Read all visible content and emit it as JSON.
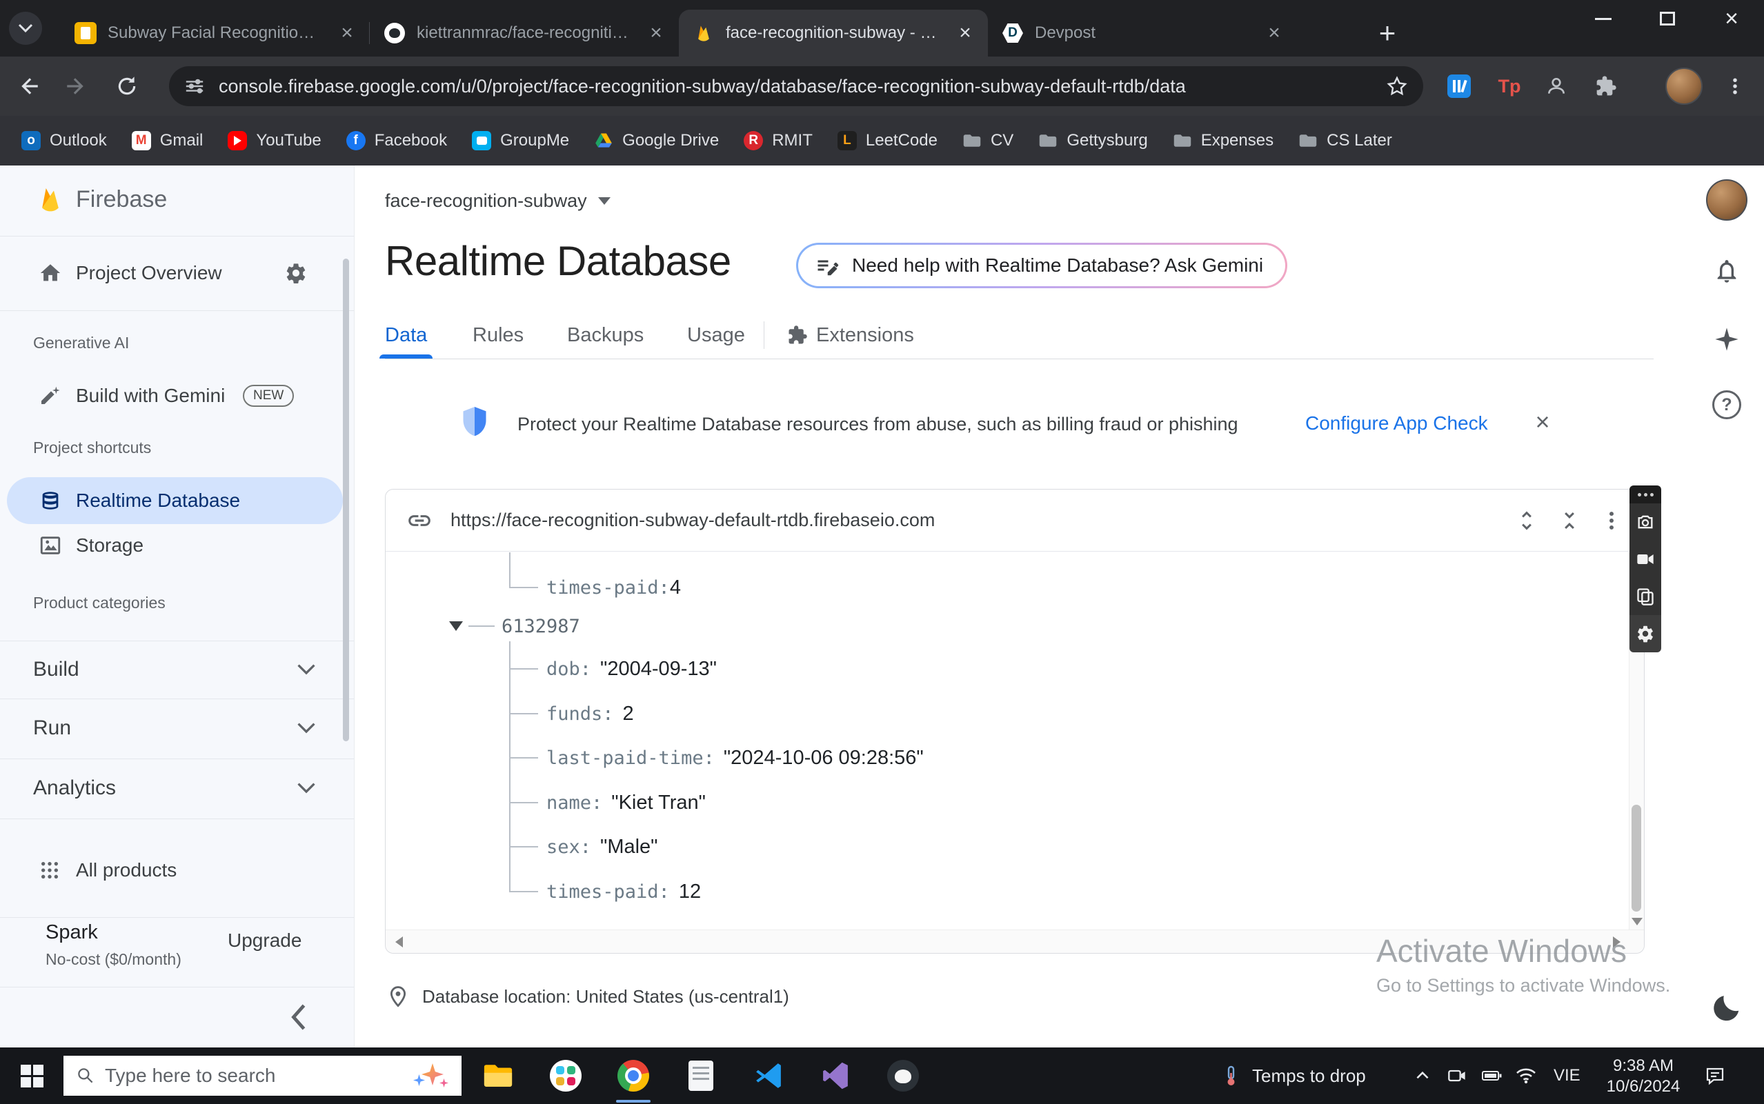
{
  "colors": {
    "accent_blue": "#1a73e8",
    "selected_nav_bg": "#d3e3fd",
    "firebase_orange": "#ffa000",
    "chrome_dark": "#202124"
  },
  "browser": {
    "tabs": [
      {
        "title": "Subway Facial Recognition - Go",
        "icon": "google-docs-icon"
      },
      {
        "title": "kiettranmrac/face-recognition-s",
        "icon": "github-icon"
      },
      {
        "title": "face-recognition-subway - Real",
        "icon": "firebase-icon"
      },
      {
        "title": "Devpost",
        "icon": "devpost-icon"
      }
    ],
    "url": "console.firebase.google.com/u/0/project/face-recognition-subway/database/face-recognition-subway-default-rtdb/data",
    "extensions": {
      "tp_label": "Tp"
    },
    "bookmarks": [
      {
        "label": "Outlook",
        "icon": "outlook-icon"
      },
      {
        "label": "Gmail",
        "icon": "gmail-icon"
      },
      {
        "label": "YouTube",
        "icon": "youtube-icon"
      },
      {
        "label": "Facebook",
        "icon": "facebook-icon"
      },
      {
        "label": "GroupMe",
        "icon": "groupme-icon"
      },
      {
        "label": "Google Drive",
        "icon": "google-drive-icon"
      },
      {
        "label": "RMIT",
        "icon": "rmit-icon"
      },
      {
        "label": "LeetCode",
        "icon": "leetcode-icon"
      },
      {
        "label": "CV",
        "icon": "folder-icon"
      },
      {
        "label": "Gettysburg",
        "icon": "folder-icon"
      },
      {
        "label": "Expenses",
        "icon": "folder-icon"
      },
      {
        "label": "CS Later",
        "icon": "folder-icon"
      }
    ]
  },
  "sidebar": {
    "brand": "Firebase",
    "project_overview": "Project Overview",
    "generative_ai_label": "Generative AI",
    "gemini_item": "Build with Gemini",
    "gemini_badge": "NEW",
    "shortcuts_label": "Project shortcuts",
    "shortcut_rtdb": "Realtime Database",
    "shortcut_storage": "Storage",
    "categories_label": "Product categories",
    "category_build": "Build",
    "category_run": "Run",
    "category_analytics": "Analytics",
    "all_products": "All products",
    "plan_name": "Spark",
    "plan_detail": "No-cost ($0/month)",
    "upgrade_label": "Upgrade"
  },
  "main": {
    "project_name": "face-recognition-subway",
    "page_title": "Realtime Database",
    "gemini_help": "Need help with Realtime Database? Ask Gemini",
    "tabs": {
      "data": "Data",
      "rules": "Rules",
      "backups": "Backups",
      "usage": "Usage",
      "extensions": "Extensions"
    },
    "banner_text": "Protect your Realtime Database resources from abuse, such as billing fraud or phishing",
    "banner_action": "Configure App Check",
    "db_url": "https://face-recognition-subway-default-rtdb.firebaseio.com",
    "tree": {
      "partial": {
        "key": "times-paid:",
        "value": "4"
      },
      "node_key": "6132987",
      "fields": [
        {
          "key": "dob:",
          "value": "\"2004-09-13\""
        },
        {
          "key": "funds:",
          "value": "2"
        },
        {
          "key": "last-paid-time:",
          "value": "\"2024-10-06 09:28:56\""
        },
        {
          "key": "name:",
          "value": "\"Kiet Tran\""
        },
        {
          "key": "sex:",
          "value": "\"Male\""
        },
        {
          "key": "times-paid:",
          "value": "12"
        }
      ]
    },
    "db_location": "Database location: United States (us-central1)",
    "watermark_line1": "Activate Windows",
    "watermark_line2": "Go to Settings to activate Windows."
  },
  "taskbar": {
    "search_placeholder": "Type here to search",
    "weather_label": "Temps to drop",
    "language": "VIE",
    "time": "9:38 AM",
    "date": "10/6/2024"
  }
}
